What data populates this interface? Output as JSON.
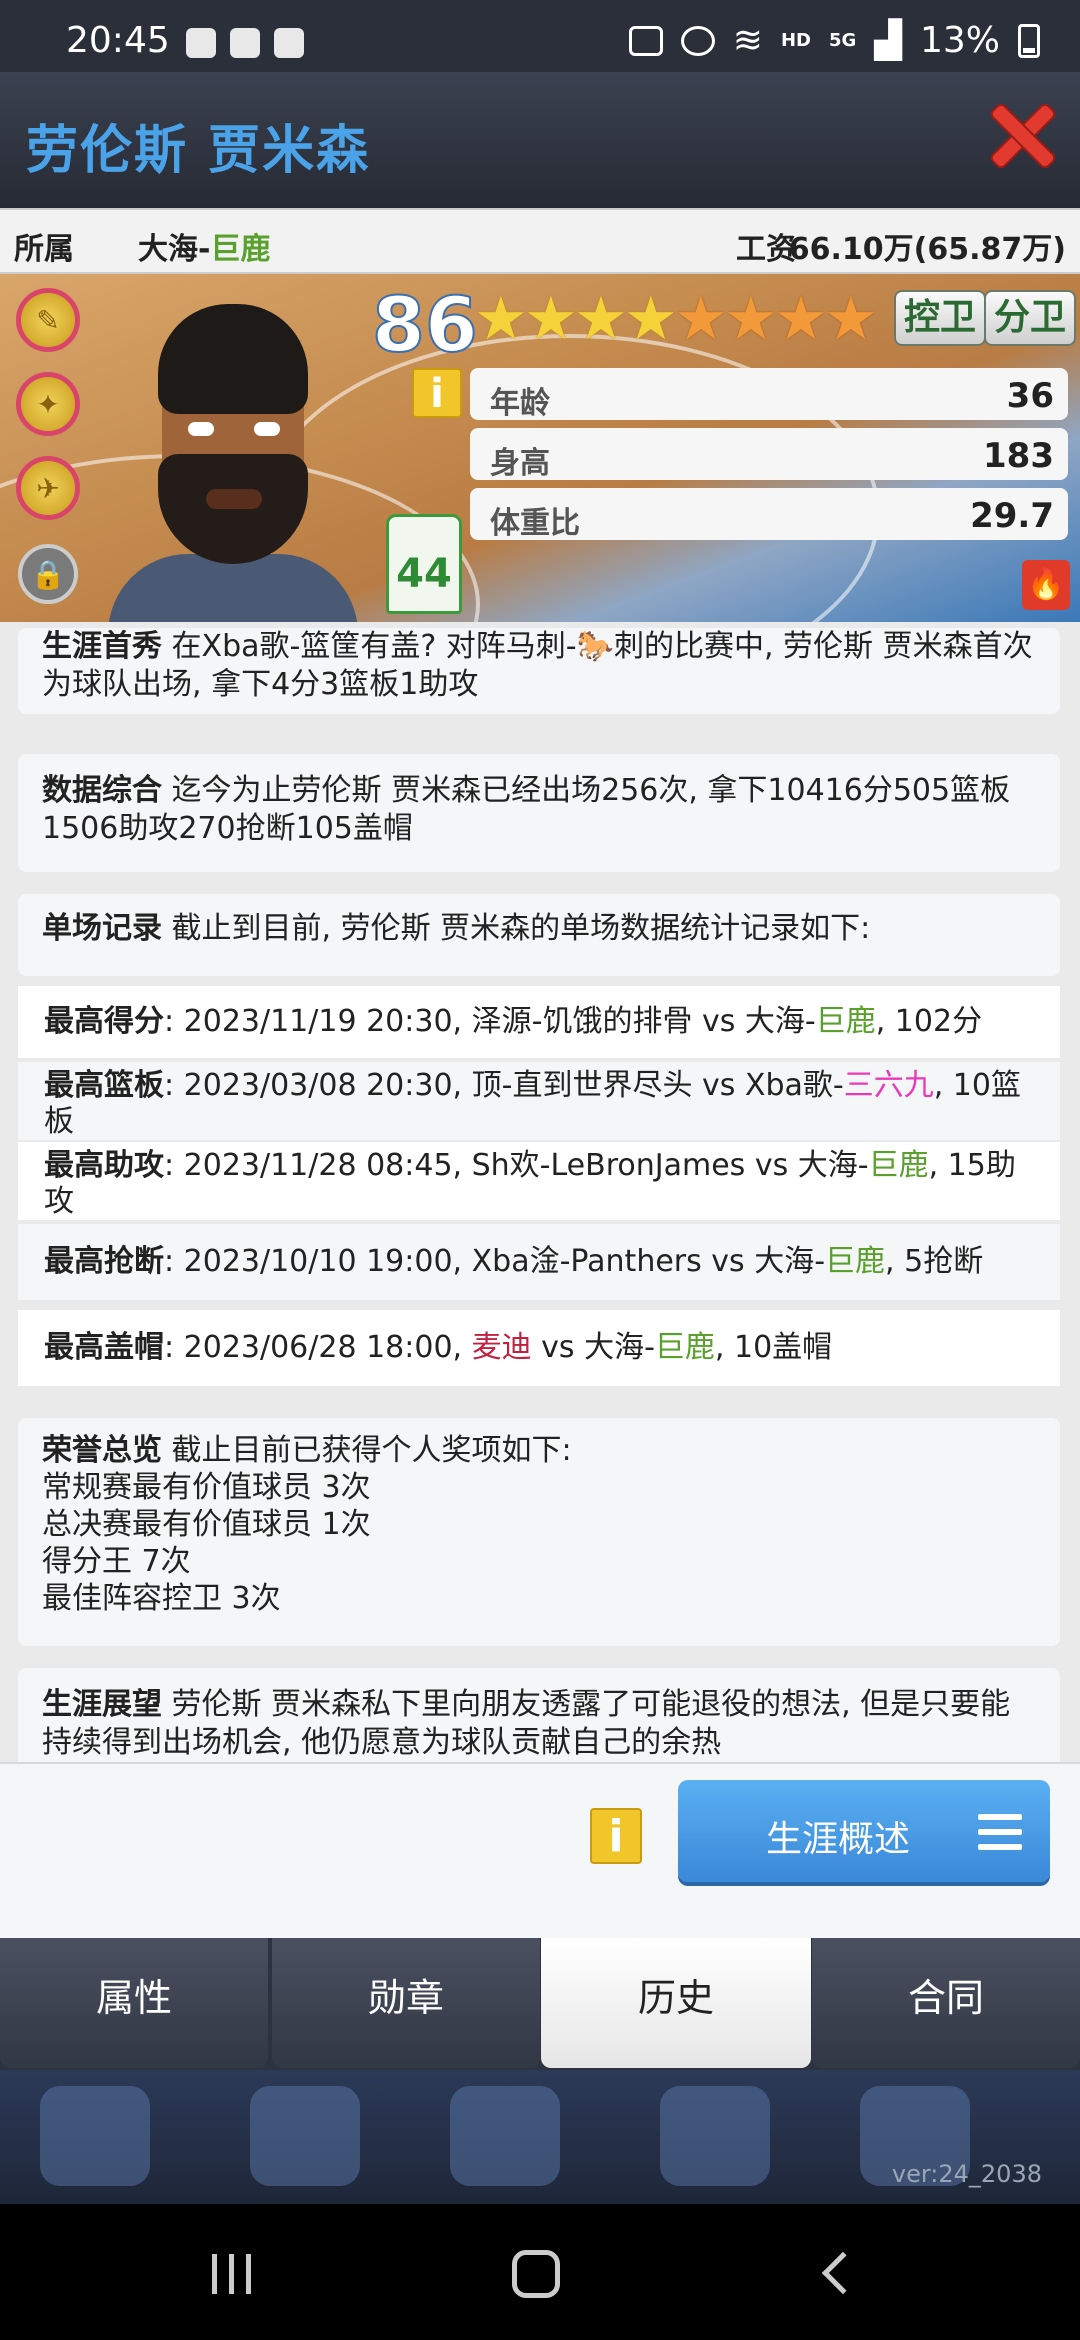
{
  "status_bar": {
    "time": "20:45",
    "network": "HD",
    "signal": "5G",
    "battery": "13%"
  },
  "header": {
    "player_name": "劳伦斯 贾米森",
    "close_icon": "close-x-icon"
  },
  "info_row": {
    "team_label": "所属",
    "team_prefix": "大海-",
    "team_name": "巨鹿",
    "salary_label": "工资",
    "salary_value": "66.10万(65.87万)"
  },
  "card": {
    "rating": "86",
    "stars_full": 4,
    "stars_orange": 4,
    "positions": [
      "控卫",
      "分卫"
    ],
    "jersey_number": "44",
    "attributes": [
      {
        "label": "年龄",
        "value": "36"
      },
      {
        "label": "身高",
        "value": "183"
      },
      {
        "label": "体重比",
        "value": "29.7"
      }
    ]
  },
  "sections": {
    "debut": {
      "title": "生涯首秀",
      "text": "在Xba歌-篮筐有盖? 对阵马刺-🐎刺的比赛中, 劳伦斯 贾米森首次为球队出场, 拿下4分3篮板1助攻"
    },
    "summary": {
      "title": "数据综合",
      "text": "迄今为止劳伦斯 贾米森已经出场256次, 拿下10416分505篮板1506助攻270抢断105盖帽"
    },
    "records": {
      "title": "单场记录",
      "text": "截止到目前, 劳伦斯 贾米森的单场数据统计记录如下:",
      "rows": [
        {
          "label": "最高得分",
          "pre": ": 2023/11/19 20:30, 泽源-饥饿的排骨 vs 大海-",
          "team": "巨鹿",
          "post": ", 102分"
        },
        {
          "label": "最高篮板",
          "pre": ": 2023/03/08 20:30, 顶-直到世界尽头 vs Xba歌-",
          "team": "三六九",
          "post": ", 10篮板"
        },
        {
          "label": "最高助攻",
          "pre": ": 2023/11/28 08:45, Sh欢-LeBronJames vs 大海-",
          "team": "巨鹿",
          "post": ", 15助攻"
        },
        {
          "label": "最高抢断",
          "pre": ": 2023/10/10 19:00, Xba淦-Panthers vs 大海-",
          "team": "巨鹿",
          "post": ", 5抢断"
        },
        {
          "label": "最高盖帽",
          "pre": ": 2023/06/28 18:00, ",
          "opp": "麦迪",
          "mid": " vs 大海-",
          "team": "巨鹿",
          "post": ", 10盖帽"
        }
      ]
    },
    "honors": {
      "title": "荣誉总览",
      "text": "截止目前已获得个人奖项如下:",
      "items": [
        "常规赛最有价值球员  3次",
        "总决赛最有价值球员  1次",
        "得分王  7次",
        "最佳阵容控卫  3次"
      ]
    },
    "outlook": {
      "title": "生涯展望",
      "text": "劳伦斯 贾米森私下里向朋友透露了可能退役的想法, 但是只要能持续得到出场机会, 他仍愿意为球队贡献自己的余热"
    }
  },
  "action": {
    "info_label": "i",
    "career_button": "生涯概述"
  },
  "tabs": [
    {
      "label": "属性",
      "active": false
    },
    {
      "label": "勋章",
      "active": false
    },
    {
      "label": "历史",
      "active": true
    },
    {
      "label": "合同",
      "active": false
    }
  ],
  "version": "ver:24_2038",
  "colors": {
    "accent_blue": "#4aa3e8",
    "team_green": "#5aa02c",
    "team_pink": "#e83ab8",
    "opp_red": "#c2203e",
    "close_red": "#e23a2e"
  }
}
